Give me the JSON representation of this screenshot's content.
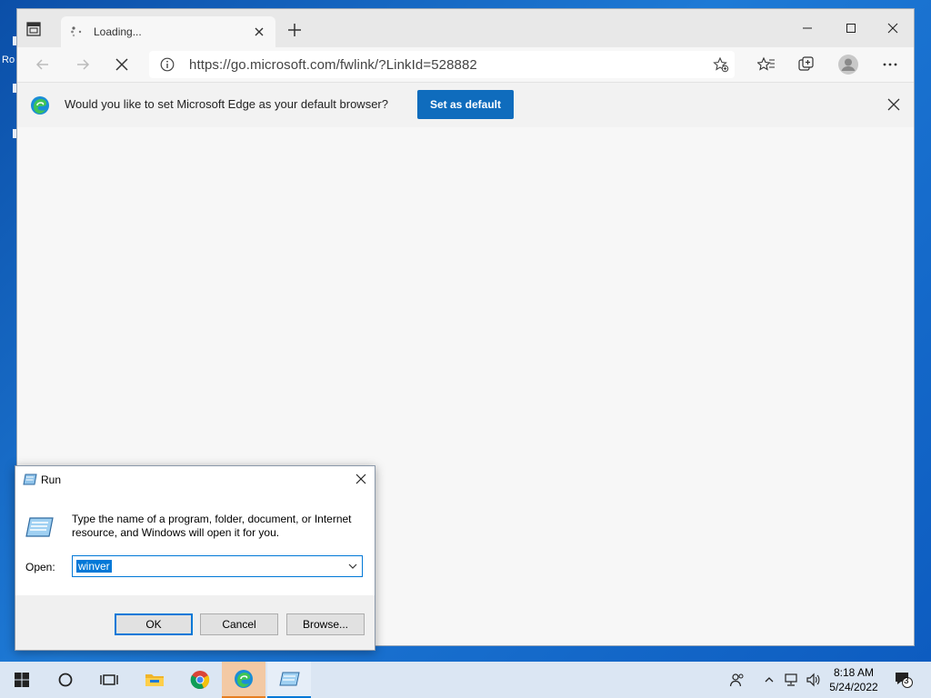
{
  "desktop": {
    "fragment_text": "Ro"
  },
  "browser": {
    "tab": {
      "title": "Loading..."
    },
    "address": {
      "url": "https://go.microsoft.com/fwlink/?LinkId=528882"
    },
    "infobar": {
      "message": "Would you like to set Microsoft Edge as your default browser?",
      "set_default_label": "Set as default"
    }
  },
  "run_dialog": {
    "title": "Run",
    "description": "Type the name of a program, folder, document, or Internet resource, and Windows will open it for you.",
    "open_label": "Open:",
    "open_value": "winver",
    "ok_label": "OK",
    "cancel_label": "Cancel",
    "browse_label": "Browse..."
  },
  "taskbar": {
    "time": "8:18 AM",
    "date": "5/24/2022",
    "notification_count": "3"
  }
}
